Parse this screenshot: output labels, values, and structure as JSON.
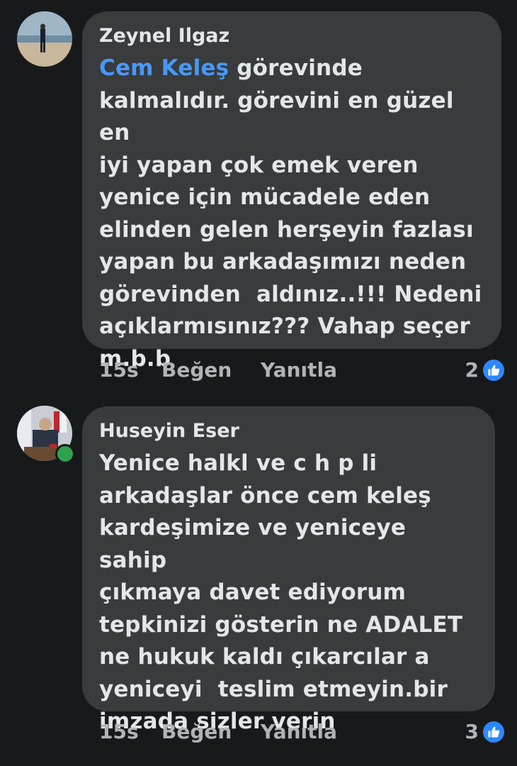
{
  "comments": [
    {
      "author": "Zeynel Ilgaz",
      "mention": "Cem Keleş",
      "body": " görevinde\nkalmalıdır. görevini en güzel en\niyi yapan çok emek veren\nyenice için mücadele eden\nelinden gelen herşeyin fazlası\nyapan bu arkadaşımızı neden\ngörevinden  aldınız..!!! Nedeni\naçıklarmısınız??? Vahap seçer\nm.b.b",
      "time": "15s",
      "like_label": "Beğen",
      "reply_label": "Yanıtla",
      "reaction_count": "2",
      "reaction_icon": "thumbs-up-icon",
      "online": false
    },
    {
      "author": "Huseyin Eser",
      "body": "Yenice halkl ve c h p li\narkadaşlar önce cem keleş\nkardeşimize ve yeniceye sahip\nçıkmaya davet ediyorum\ntepkinizi gösterin ne ADALET\nne hukuk kaldı çıkarcılar a\nyeniceyi  teslim etmeyin.bir\nimzada sizler verin",
      "time": "15s",
      "like_label": "Beğen",
      "reply_label": "Yanıtla",
      "reaction_count": "3",
      "reaction_icon": "thumbs-up-icon",
      "online": true
    }
  ],
  "colors": {
    "background": "#18191a",
    "bubble": "#3a3b3c",
    "mention": "#4599ff",
    "like_badge": "#2d88ff",
    "online": "#31a24c"
  }
}
